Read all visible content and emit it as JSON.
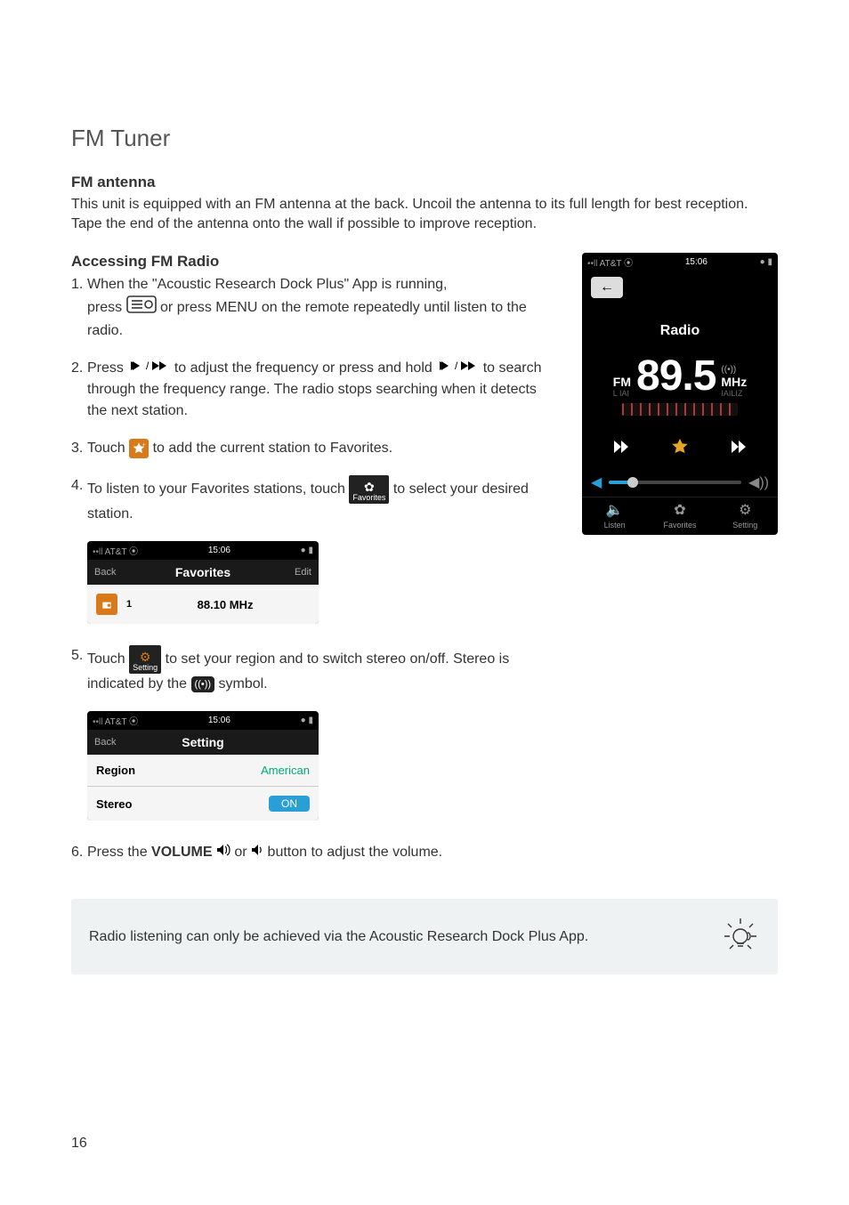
{
  "page": {
    "title": "FM Tuner",
    "number": "16"
  },
  "antenna": {
    "heading": "FM antenna",
    "text": "This unit is equipped with an FM antenna at the back. Uncoil the antenna to its full length for best reception. Tape the end of the antenna onto the wall if possible to improve reception."
  },
  "accessing": {
    "heading": "Accessing FM Radio",
    "step1_a": "When the \"Acoustic Research Dock Plus\" App is running,",
    "step1_b": "press",
    "step1_c": "or press MENU on the remote repeatedly until listen to the radio.",
    "step2_a": "Press",
    "step2_b": "to adjust the frequency or press and hold",
    "step2_c": "to search through the frequency range. The radio stops searching when it detects the next station.",
    "step3_a": "Touch",
    "step3_b": "to add the current station to Favorites.",
    "step4_a": "To listen to your Favorites stations, touch",
    "step4_b": "to select your desired station.",
    "step5_a": "Touch",
    "step5_b": "to set your region and to switch stereo on/off. Stereo is indicated by the",
    "step5_c": "symbol.",
    "step6_a": "Press the",
    "step6_b": "VOLUME",
    "step6_c": "or",
    "step6_d": "button to adjust the volume."
  },
  "radio_mock": {
    "carrier": "AT&T",
    "time": "15:06",
    "back_arrow": "←",
    "title": "Radio",
    "fm_label": "FM",
    "frequency": "89.5",
    "unit": "MHz",
    "tabs": {
      "listen": "Listen",
      "favorites": "Favorites",
      "setting": "Setting"
    }
  },
  "favorites_mock": {
    "carrier": "AT&T",
    "time": "15:06",
    "back": "Back",
    "title": "Favorites",
    "edit": "Edit",
    "row_index": "1",
    "row_freq": "88.10 MHz"
  },
  "setting_mock": {
    "carrier": "AT&T",
    "time": "15:06",
    "back": "Back",
    "title": "Setting",
    "region_label": "Region",
    "region_value": "American",
    "stereo_label": "Stereo",
    "stereo_value": "ON"
  },
  "inline_icons": {
    "favorites_label": "Favorites",
    "setting_label": "Setting"
  },
  "note": {
    "text": "Radio listening can only be achieved via the Acoustic Research Dock Plus App."
  }
}
